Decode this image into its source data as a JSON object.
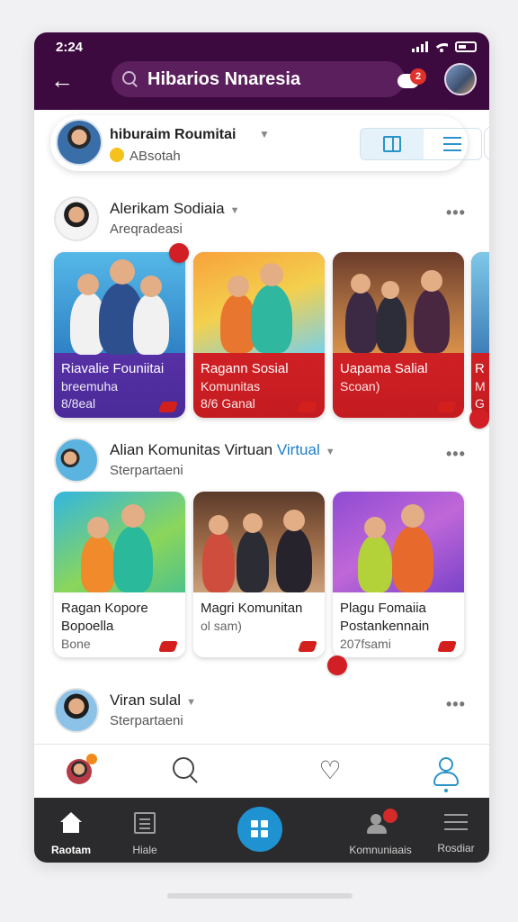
{
  "status": {
    "time": "2:24"
  },
  "header": {
    "search_text": "Hibarios Nnaresia",
    "notification_badge": "2"
  },
  "profile": {
    "name": "hiburaim Roumitai",
    "subtitle": "ABsotah"
  },
  "sections": [
    {
      "title": "Alerikam Sodiaia",
      "title_highlight": "",
      "subtitle": "Areqradeasi",
      "cards": [
        {
          "title": "Riavalie Founiitai",
          "line2": "breemuha",
          "line3": "8/8eal"
        },
        {
          "title": "Ragann Sosial",
          "line2": "Komunitas",
          "line3": "8/6 Ganal"
        },
        {
          "title": "Uapama Salial",
          "line2": "Scoan)",
          "line3": ""
        },
        {
          "title": "R",
          "line2": "M",
          "line3": "G"
        }
      ]
    },
    {
      "title": "Alian Komunitas Virtuan",
      "title_highlight": "Virtual",
      "subtitle": "Sterpartaeni",
      "cards": [
        {
          "title": "Ragan Kopore",
          "line2": "Bopoella",
          "line3": "Bone"
        },
        {
          "title": "Magri Komunitan",
          "line2": "ol sam)",
          "line3": ""
        },
        {
          "title": "Plagu Fomaiia",
          "line2": "Postankennain",
          "line3": "207fsami"
        }
      ]
    },
    {
      "title": "Viran sulal",
      "title_highlight": "",
      "subtitle": "Sterpartaeni"
    }
  ],
  "bottom_nav": [
    {
      "label": "Raotam",
      "icon": "home-icon"
    },
    {
      "label": "Hiale",
      "icon": "document-icon"
    },
    {
      "label": "",
      "icon": "grid-icon"
    },
    {
      "label": "Komnuniaais",
      "icon": "community-icon"
    },
    {
      "label": "Rosdiar",
      "icon": "menu-icon"
    }
  ],
  "colors": {
    "header": "#3d0a3f",
    "accent": "#1f93d1",
    "badge": "#d11f25"
  }
}
